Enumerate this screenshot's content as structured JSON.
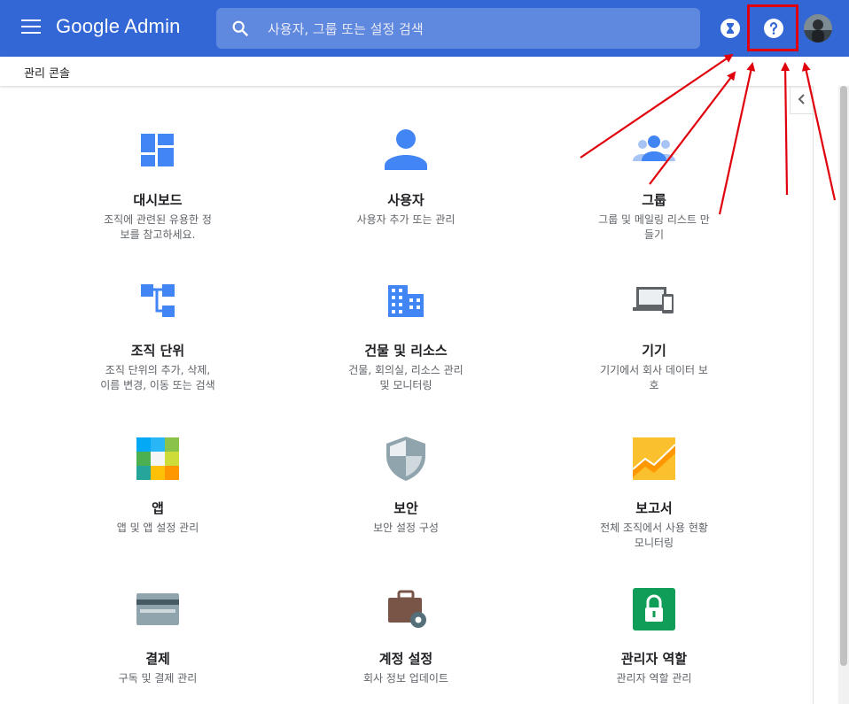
{
  "header": {
    "app_title": "Google Admin",
    "search_placeholder": "사용자, 그룹 또는 설정 검색",
    "brand_color": "#3367d6"
  },
  "breadcrumb": "관리 콘솔",
  "cards": [
    {
      "title": "대시보드",
      "desc": "조직에 관련된 유용한 정보를 참고하세요.",
      "icon": "dashboard-icon"
    },
    {
      "title": "사용자",
      "desc": "사용자 추가 또는 관리",
      "icon": "user-icon"
    },
    {
      "title": "그룹",
      "desc": "그룹 및 메일링 리스트 만들기",
      "icon": "group-icon"
    },
    {
      "title": "조직 단위",
      "desc": "조직 단위의 추가, 삭제, 이름 변경, 이동 또는 검색",
      "icon": "org-unit-icon"
    },
    {
      "title": "건물 및 리소스",
      "desc": "건물, 회의실, 리소스 관리 및 모니터링",
      "icon": "building-icon"
    },
    {
      "title": "기기",
      "desc": "기기에서 회사 데이터 보호",
      "icon": "devices-icon"
    },
    {
      "title": "앱",
      "desc": "앱 및 앱 설정 관리",
      "icon": "apps-icon"
    },
    {
      "title": "보안",
      "desc": "보안 설정 구성",
      "icon": "security-shield-icon"
    },
    {
      "title": "보고서",
      "desc": "전체 조직에서 사용 현황 모니터링",
      "icon": "reports-chart-icon"
    },
    {
      "title": "결제",
      "desc": "구독 및 결제 관리",
      "icon": "billing-card-icon"
    },
    {
      "title": "계정 설정",
      "desc": "회사 정보 업데이트",
      "icon": "account-settings-icon"
    },
    {
      "title": "관리자 역할",
      "desc": "관리자 역할 관리",
      "icon": "admin-roles-lock-icon"
    }
  ],
  "colors": {
    "annotation_red": "#e0000d",
    "icon_blue": "#4285f4"
  }
}
